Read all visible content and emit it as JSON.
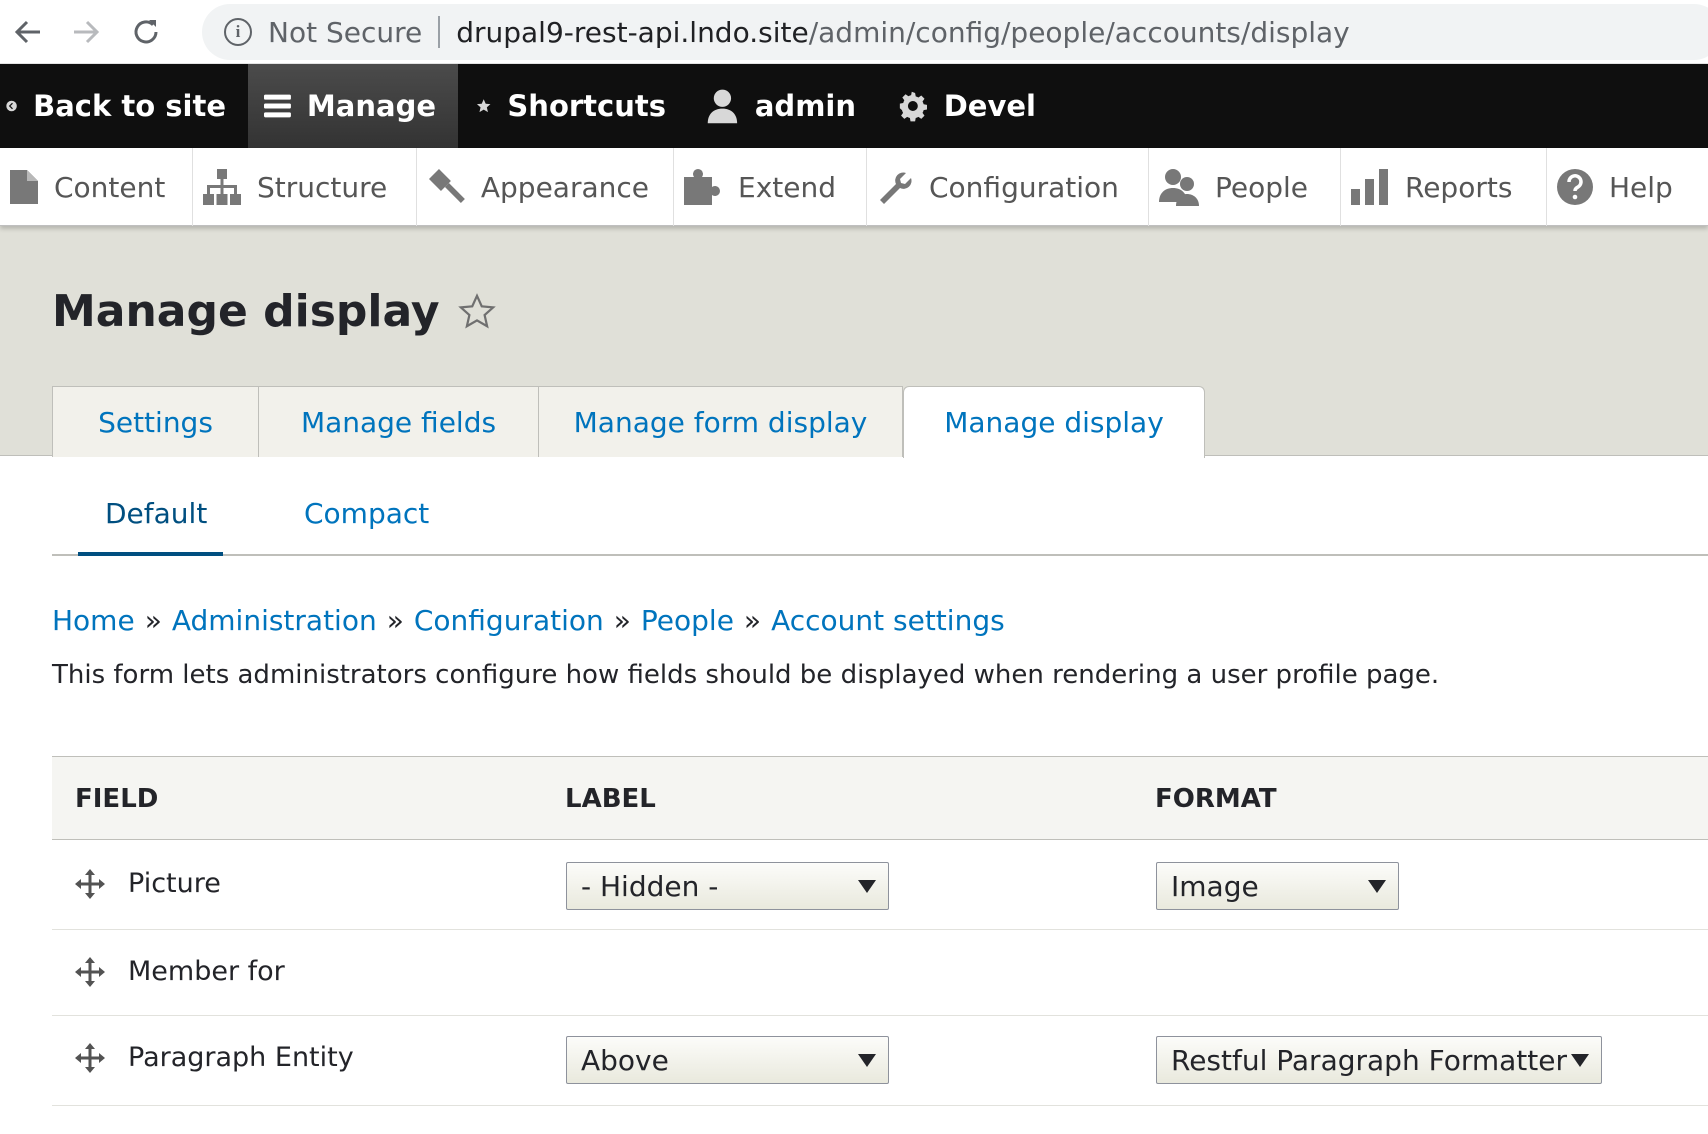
{
  "browser": {
    "security_label": "Not Secure",
    "url_host": "drupal9-rest-api.lndo.site",
    "url_path": "/admin/config/people/accounts/display"
  },
  "toolbar": {
    "back_to_site": "Back to site",
    "manage": "Manage",
    "shortcuts": "Shortcuts",
    "user": "admin",
    "devel": "Devel"
  },
  "admin_menu": [
    {
      "label": "Content",
      "icon": "content-icon"
    },
    {
      "label": "Structure",
      "icon": "structure-icon"
    },
    {
      "label": "Appearance",
      "icon": "appearance-icon"
    },
    {
      "label": "Extend",
      "icon": "extend-icon"
    },
    {
      "label": "Configuration",
      "icon": "configuration-icon"
    },
    {
      "label": "People",
      "icon": "people-icon"
    },
    {
      "label": "Reports",
      "icon": "reports-icon"
    },
    {
      "label": "Help",
      "icon": "help-icon"
    }
  ],
  "page": {
    "title": "Manage display"
  },
  "primary_tabs": [
    {
      "label": "Settings",
      "active": false
    },
    {
      "label": "Manage fields",
      "active": false
    },
    {
      "label": "Manage form display",
      "active": false
    },
    {
      "label": "Manage display",
      "active": true
    }
  ],
  "secondary_tabs": [
    {
      "label": "Default",
      "active": true
    },
    {
      "label": "Compact",
      "active": false
    }
  ],
  "breadcrumb": [
    "Home",
    "Administration",
    "Configuration",
    "People",
    "Account settings"
  ],
  "breadcrumb_separator": "»",
  "description": "This form lets administrators configure how fields should be displayed when rendering a user profile page.",
  "table": {
    "headers": {
      "field": "FIELD",
      "label": "LABEL",
      "format": "FORMAT"
    },
    "rows": [
      {
        "field": "Picture",
        "label": "- Hidden -",
        "format": "Image"
      },
      {
        "field": "Member for",
        "label": "",
        "format": ""
      },
      {
        "field": "Paragraph Entity",
        "label": "Above",
        "format": "Restful Paragraph Formatter"
      }
    ]
  },
  "colors": {
    "toolbar_bg": "#0f0f0f",
    "link": "#0074bd",
    "header_bg": "#e0e0d8"
  }
}
